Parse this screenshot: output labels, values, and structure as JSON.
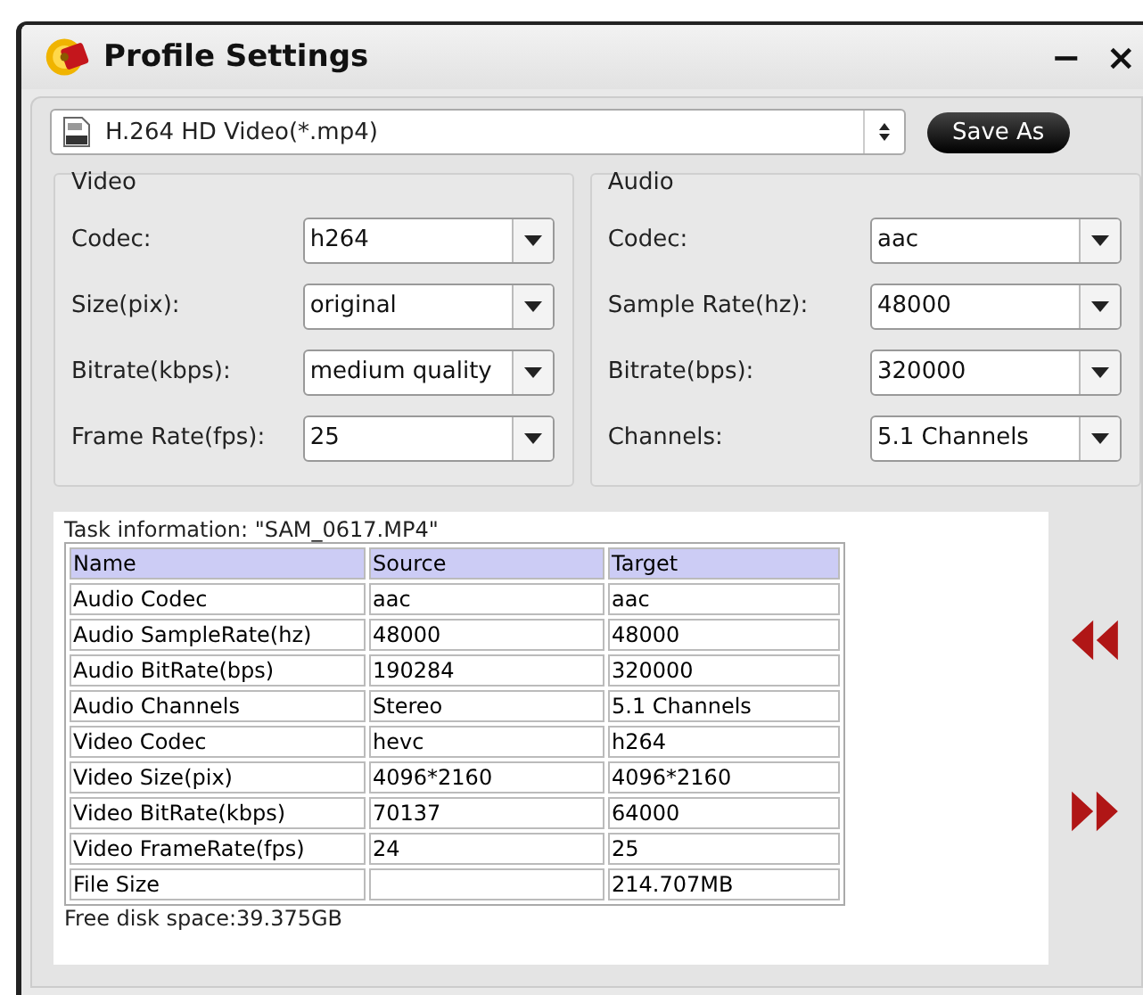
{
  "window": {
    "title": "Profile Settings",
    "controls": [
      "−",
      "×"
    ]
  },
  "profile": {
    "value": "H.264 HD Video(*.mp4)",
    "save_button": "Save As"
  },
  "video": {
    "title": "Video",
    "fields": [
      {
        "label": "Codec:",
        "value": "h264"
      },
      {
        "label": "Size(pix):",
        "value": "original"
      },
      {
        "label": "Bitrate(kbps):",
        "value": "medium quality"
      },
      {
        "label": "Frame Rate(fps):",
        "value": "25"
      }
    ]
  },
  "audio": {
    "title": "Audio",
    "fields": [
      {
        "label": "Codec:",
        "value": "aac"
      },
      {
        "label": "Sample Rate(hz):",
        "value": "48000"
      },
      {
        "label": "Bitrate(bps):",
        "value": "320000"
      },
      {
        "label": "Channels:",
        "value": "5.1 Channels"
      }
    ]
  },
  "task_info": {
    "title": "Task information: \"SAM_0617.MP4\"",
    "columns": [
      "Name",
      "Source",
      "Target"
    ],
    "rows": [
      [
        "Audio Codec",
        "aac",
        "aac"
      ],
      [
        "Audio SampleRate(hz)",
        "48000",
        "48000"
      ],
      [
        "Audio BitRate(bps)",
        "190284",
        "320000"
      ],
      [
        "Audio Channels",
        "Stereo",
        "5.1 Channels"
      ],
      [
        "Video Codec",
        "hevc",
        "h264"
      ],
      [
        "Video Size(pix)",
        "4096*2160",
        "4096*2160"
      ],
      [
        "Video BitRate(kbps)",
        "70137",
        "64000"
      ],
      [
        "Video FrameRate(fps)",
        "24",
        "25"
      ],
      [
        "File Size",
        "",
        "214.707MB"
      ]
    ],
    "free_space": "Free disk space:39.375GB"
  }
}
